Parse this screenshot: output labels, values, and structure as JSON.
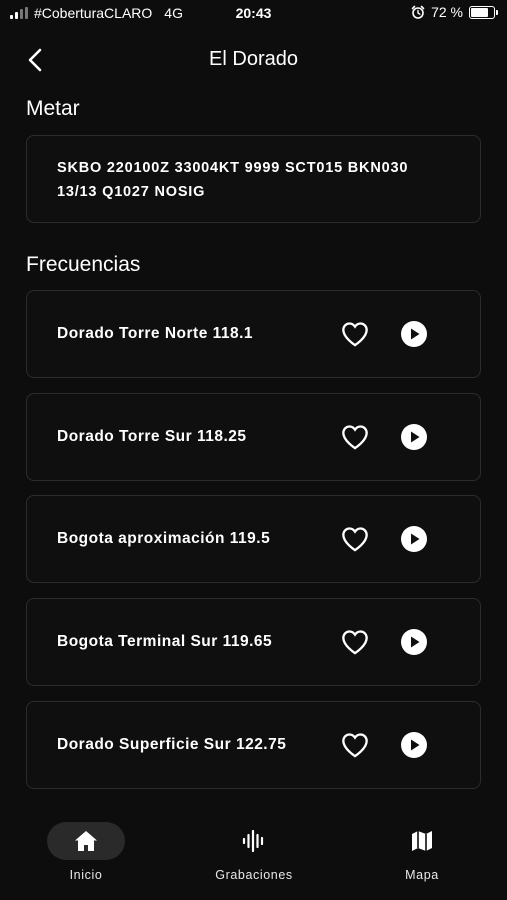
{
  "status_bar": {
    "carrier": "#CoberturaCLARO",
    "network": "4G",
    "time": "20:43",
    "battery": "72 %",
    "battery_level": 0.72
  },
  "header": {
    "title": "El Dorado",
    "back_icon": "chevron-left-icon"
  },
  "metar": {
    "section_title": "Metar",
    "text": "SKBO 220100Z 33004KT 9999 SCT015 BKN030 13/13 Q1027 NOSIG"
  },
  "frequencies": {
    "section_title": "Frecuencias",
    "items": [
      {
        "label": "Dorado Torre Norte 118.1"
      },
      {
        "label": "Dorado Torre Sur 118.25"
      },
      {
        "label": "Bogota aproximación 119.5"
      },
      {
        "label": "Bogota Terminal Sur 119.65"
      },
      {
        "label": "Dorado Superficie Sur 122.75"
      }
    ]
  },
  "tabbar": {
    "items": [
      {
        "label": "Inicio",
        "icon": "home-icon",
        "active": true
      },
      {
        "label": "Grabaciones",
        "icon": "waveform-icon",
        "active": false
      },
      {
        "label": "Mapa",
        "icon": "map-icon",
        "active": false
      }
    ]
  },
  "colors": {
    "background": "#0d0d0d",
    "card_border": "#2c2c2c",
    "active_tab": "#2a2a2a",
    "text": "#ffffff"
  }
}
